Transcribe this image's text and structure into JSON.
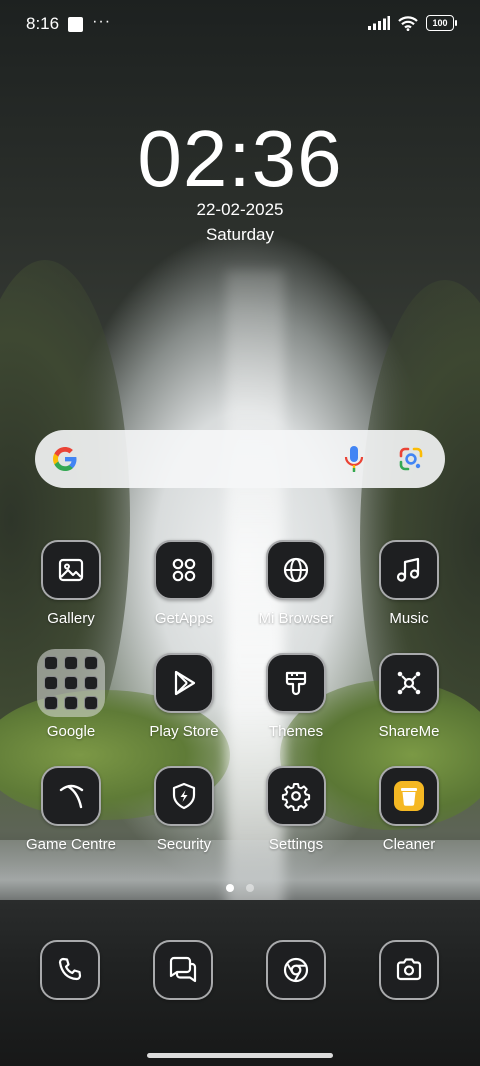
{
  "status_bar": {
    "time": "8:16",
    "overflow_dots": "···",
    "battery_level": "100"
  },
  "lock_clock": {
    "time": "02:36",
    "date": "22-02-2025",
    "weekday": "Saturday"
  },
  "search_bar": {
    "icons": [
      "google-g-icon",
      "microphone-icon",
      "google-lens-icon"
    ]
  },
  "apps": [
    {
      "label": "Gallery",
      "icon": "gallery-icon"
    },
    {
      "label": "GetApps",
      "icon": "getapps-icon"
    },
    {
      "label": "Mi Browser",
      "icon": "globe-icon"
    },
    {
      "label": "Music",
      "icon": "music-note-icon"
    },
    {
      "label": "Google",
      "icon": "folder-icon"
    },
    {
      "label": "Play Store",
      "icon": "play-store-icon"
    },
    {
      "label": "Themes",
      "icon": "paintbrush-icon"
    },
    {
      "label": "ShareMe",
      "icon": "shareme-icon"
    },
    {
      "label": "Game Centre",
      "icon": "game-centre-icon"
    },
    {
      "label": "Security",
      "icon": "shield-bolt-icon"
    },
    {
      "label": "Settings",
      "icon": "gear-icon"
    },
    {
      "label": "Cleaner",
      "icon": "trash-bin-icon"
    }
  ],
  "page_indicator": {
    "pages": 2,
    "current": 1
  },
  "dock": [
    {
      "icon": "phone-icon"
    },
    {
      "icon": "messages-icon"
    },
    {
      "icon": "chrome-icon"
    },
    {
      "icon": "camera-icon"
    }
  ],
  "colors": {
    "icon_bg": "#1e1f21",
    "icon_border": "#a9aaac",
    "cleaner_accent": "#f5b823"
  }
}
